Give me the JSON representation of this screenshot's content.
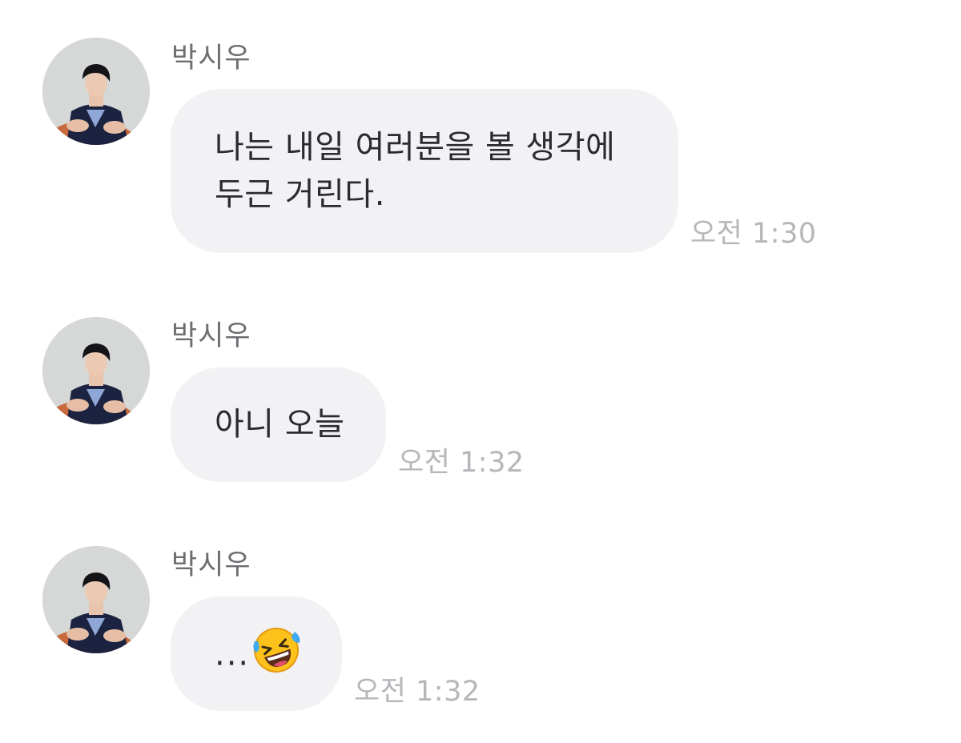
{
  "messages": [
    {
      "sender": "박시우",
      "text": "나는 내일 여러분을 볼 생각에\n두근 거린다.",
      "time": "오전 1:30"
    },
    {
      "sender": "박시우",
      "text": "아니 오늘",
      "time": "오전 1:32"
    },
    {
      "sender": "박시우",
      "text": "...",
      "emoji": "rolling-on-the-floor-laughing-icon",
      "time": "오전 1:32"
    }
  ],
  "colors": {
    "background": "#ffffff",
    "bubble": "#f2f2f4",
    "message_text": "#2b2b2f",
    "sender_name": "#6d6d72",
    "timestamp": "#b6b6bb"
  }
}
